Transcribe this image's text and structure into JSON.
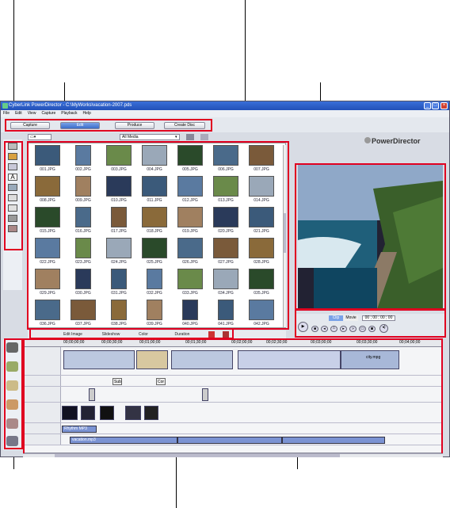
{
  "window": {
    "title": "CyberLink PowerDirector - C:\\MyWorks\\vacation-2007.pds",
    "brand": "PowerDirector"
  },
  "menu": [
    "File",
    "Edit",
    "View",
    "Capture",
    "Playback",
    "Help"
  ],
  "modes": {
    "items": [
      "Capture",
      "Edit",
      "Produce",
      "Create Disc"
    ],
    "active": "Edit"
  },
  "library": {
    "filter": "All Media",
    "files": [
      "001.JPG",
      "002.JPG",
      "003.JPG",
      "004.JPG",
      "005.JPG",
      "006.JPG",
      "007.JPG",
      "008.JPG",
      "009.JPG",
      "010.JPG",
      "011.JPG",
      "012.JPG",
      "013.JPG",
      "014.JPG",
      "015.JPG",
      "016.JPG",
      "017.JPG",
      "018.JPG",
      "019.JPG",
      "020.JPG",
      "021.JPG",
      "022.JPG",
      "023.JPG",
      "024.JPG",
      "025.JPG",
      "026.JPG",
      "027.JPG",
      "028.JPG",
      "029.JPG",
      "030.JPG",
      "031.JPG",
      "032.JPG",
      "033.JPG",
      "034.JPG",
      "035.JPG",
      "036.JPG",
      "037.JPG",
      "038.JPG",
      "039.JPG",
      "040.JPG",
      "041.JPG",
      "042.JPG"
    ],
    "bottom_buttons": [
      "Edit Image",
      "Slideshow",
      "Color",
      "Duration"
    ]
  },
  "preview": {
    "clip_label": "Clip",
    "movie_label": "Movie",
    "timecode": "00 ; 00 ; 00 ; 00"
  },
  "timeline": {
    "ruler": [
      "00;00;00;00",
      "00;00;30;00",
      "00;01;00;00",
      "00;01;30;00",
      "00;02;00;00",
      "00;02;30;00",
      "00;03;00;00",
      "00;03;30;00",
      "00;04;00;00"
    ],
    "video_clip_label": "city.mpg",
    "text_clips": [
      "Sub",
      "Cor"
    ],
    "voice_clip": "Rhythm MP3",
    "audio_clip": "vacation.mp3"
  },
  "colors": {
    "highlight": "#e00020",
    "titlebar": "#2250b8"
  }
}
